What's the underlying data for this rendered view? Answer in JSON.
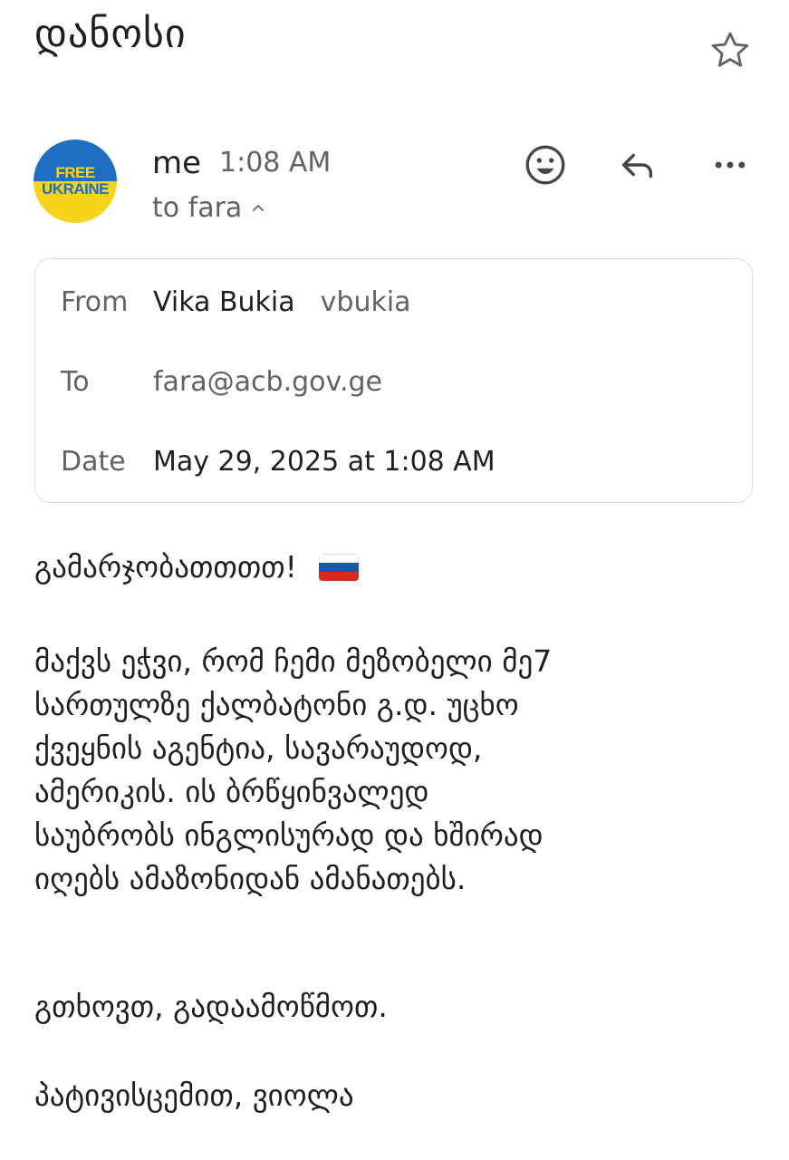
{
  "email": {
    "subject": "დანოსი",
    "avatar": {
      "line1": "FREE",
      "line2": "UKRAINE"
    },
    "sender": "me",
    "time": "1:08 AM",
    "to_summary": "to fara",
    "details": {
      "from_label": "From",
      "from_name": "Vika Bukia",
      "from_user": "vbukia",
      "to_label": "To",
      "to_value": "fara@acb.gov.ge",
      "date_label": "Date",
      "date_value": "May 29, 2025 at 1:08 AM"
    },
    "body": {
      "greeting": "გამარჯობათთთთ!",
      "paragraph": [
        "მაქვს ეჭვი, რომ ჩემი მეზობელი მე7",
        "სართულზე ქალბატონი გ.დ. უცხო",
        "ქვეყნის აგენტია, სავარაუდოდ,",
        "ამერიკის. ის ბრწყინვალედ",
        "საუბრობს ინგლისურად და ხშირად",
        "იღებს ამაზონიდან ამანათებს."
      ],
      "request": "გთხოვთ, გადაამოწმოთ.",
      "closing": "პატივისცემით, ვიოლა"
    }
  },
  "icons": {
    "star": "star-outline-icon",
    "emoji": "smiley-icon",
    "reply": "reply-icon",
    "more": "more-horizontal-icon",
    "chevron": "chevron-up-icon",
    "flag": "russia-flag-emoji"
  },
  "colors": {
    "flag_white": "#ffffff",
    "flag_blue": "#1c57a5",
    "flag_red": "#d52b1e"
  }
}
